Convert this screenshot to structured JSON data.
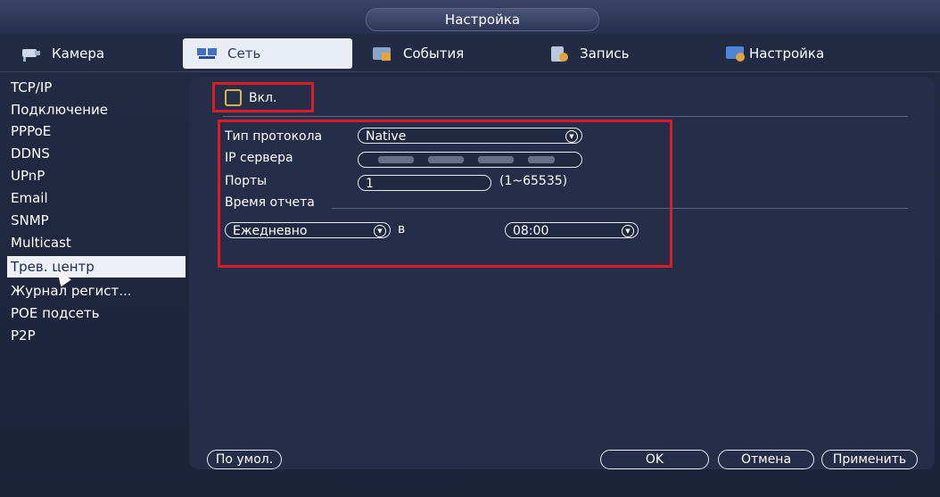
{
  "window": {
    "title": "Настройка"
  },
  "tabs": [
    {
      "label": "Камера",
      "icon": "camera-icon"
    },
    {
      "label": "Сеть",
      "icon": "network-icon"
    },
    {
      "label": "События",
      "icon": "events-icon"
    },
    {
      "label": "Запись",
      "icon": "record-icon"
    },
    {
      "label": "Настройка",
      "icon": "settings-icon"
    }
  ],
  "sidebar": {
    "items": [
      {
        "label": "TCP/IP"
      },
      {
        "label": "Подключение"
      },
      {
        "label": "PPPoE"
      },
      {
        "label": "DDNS"
      },
      {
        "label": "UPnP"
      },
      {
        "label": "Email"
      },
      {
        "label": "SNMP"
      },
      {
        "label": "Multicast"
      },
      {
        "label": "Трев. центр"
      },
      {
        "label": "Журнал регист..."
      },
      {
        "label": "POE подсеть"
      },
      {
        "label": "P2P"
      }
    ],
    "selected": "Трев. центр"
  },
  "form": {
    "enable_label": "Вкл.",
    "enable_checked": false,
    "protocol_label": "Тип протокола",
    "protocol_value": "Native",
    "server_ip_label": "IP сервера",
    "port_label": "Порты",
    "port_value": "1",
    "port_range": "(1~65535)",
    "report_time_label": "Время отчета",
    "frequency_value": "Ежедневно",
    "at_label": "в",
    "time_value": "08:00"
  },
  "buttons": {
    "default_label": "По умол.",
    "ok_label": "OK",
    "cancel_label": "Отмена",
    "apply_label": "Применить"
  },
  "colors": {
    "highlight_red": "#d81d29",
    "active_tab": "#e9eef6",
    "background": "#1b2238"
  }
}
